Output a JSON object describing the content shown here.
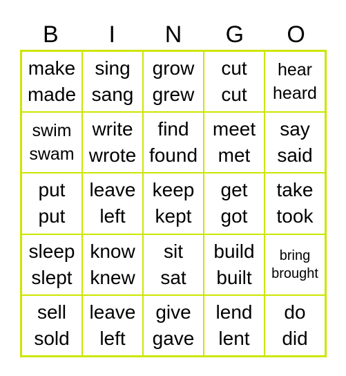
{
  "header": [
    "B",
    "I",
    "N",
    "G",
    "O"
  ],
  "cells": [
    [
      "make",
      "made"
    ],
    [
      "sing",
      "sang"
    ],
    [
      "grow",
      "grew"
    ],
    [
      "cut",
      "cut"
    ],
    [
      "hear",
      "heard"
    ],
    [
      "swim",
      "swam"
    ],
    [
      "write",
      "wrote"
    ],
    [
      "find",
      "found"
    ],
    [
      "meet",
      "met"
    ],
    [
      "say",
      "said"
    ],
    [
      "put",
      "put"
    ],
    [
      "leave",
      "left"
    ],
    [
      "keep",
      "kept"
    ],
    [
      "get",
      "got"
    ],
    [
      "take",
      "took"
    ],
    [
      "sleep",
      "slept"
    ],
    [
      "know",
      "knew"
    ],
    [
      "sit",
      "sat"
    ],
    [
      "build",
      "built"
    ],
    [
      "bring",
      "brought"
    ],
    [
      "sell",
      "sold"
    ],
    [
      "leave",
      "left"
    ],
    [
      "give",
      "gave"
    ],
    [
      "lend",
      "lent"
    ],
    [
      "do",
      "did"
    ]
  ],
  "colors": {
    "border": "#CCE600"
  }
}
